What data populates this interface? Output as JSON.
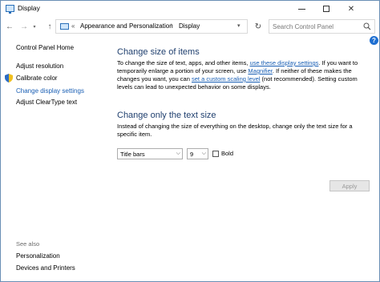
{
  "window": {
    "title": "Display"
  },
  "nav": {
    "breadcrumb_prefix": "«",
    "crumbs": [
      "Appearance and Personalization",
      "Display"
    ],
    "separator": "›"
  },
  "search": {
    "placeholder": "Search Control Panel"
  },
  "left_nav": {
    "home": "Control Panel Home",
    "links": [
      "Adjust resolution",
      "Calibrate color",
      "Change display settings",
      "Adjust ClearType text"
    ],
    "see_also_label": "See also",
    "see_also": [
      "Personalization",
      "Devices and Printers"
    ]
  },
  "main": {
    "section1_title": "Change size of items",
    "section1_text_a": "To change the size of text, apps, and other items, ",
    "section1_link_a": "use these display settings",
    "section1_text_b": ". If you want to temporarily enlarge a portion of your screen, use ",
    "section1_link_b": "Magnifier",
    "section1_text_c": ".  If neither of these makes the changes you want, you can ",
    "section1_link_c": "set a custom scaling level",
    "section1_text_d": " (not recommended).  Setting custom levels can lead to unexpected behavior on some displays.",
    "section2_title": "Change only the text size",
    "section2_text": "Instead of changing the size of everything on the desktop, change only the text size for a specific item.",
    "item_select_value": "Title bars",
    "size_select_value": "9",
    "bold_label": "Bold",
    "bold_checked": false,
    "apply_label": "Apply"
  },
  "colors": {
    "link": "#1a5fb4",
    "heading": "#1f3f6e",
    "help": "#1e6fd1"
  }
}
